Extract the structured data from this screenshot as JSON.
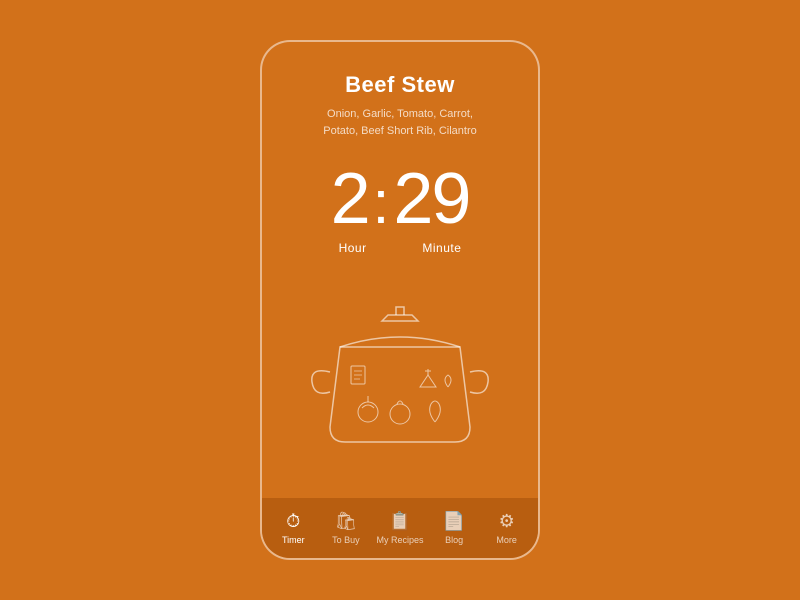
{
  "app": {
    "background_color": "#D2711A",
    "nav_bar_color": "#B85E10"
  },
  "recipe": {
    "title": "Beef Stew",
    "ingredients": "Onion, Garlic, Tomato, Carrot,\nPotato, Beef Short Rib, Cilantro"
  },
  "timer": {
    "hour": "2",
    "colon": ":",
    "minute": "29",
    "hour_label": "Hour",
    "minute_label": "Minute"
  },
  "nav": {
    "items": [
      {
        "id": "timer",
        "label": "Timer",
        "active": true
      },
      {
        "id": "to-buy",
        "label": "To Buy",
        "active": false
      },
      {
        "id": "my-recipes",
        "label": "My Recipes",
        "active": false
      },
      {
        "id": "blog",
        "label": "Blog",
        "active": false
      },
      {
        "id": "more",
        "label": "More",
        "active": false
      }
    ]
  }
}
